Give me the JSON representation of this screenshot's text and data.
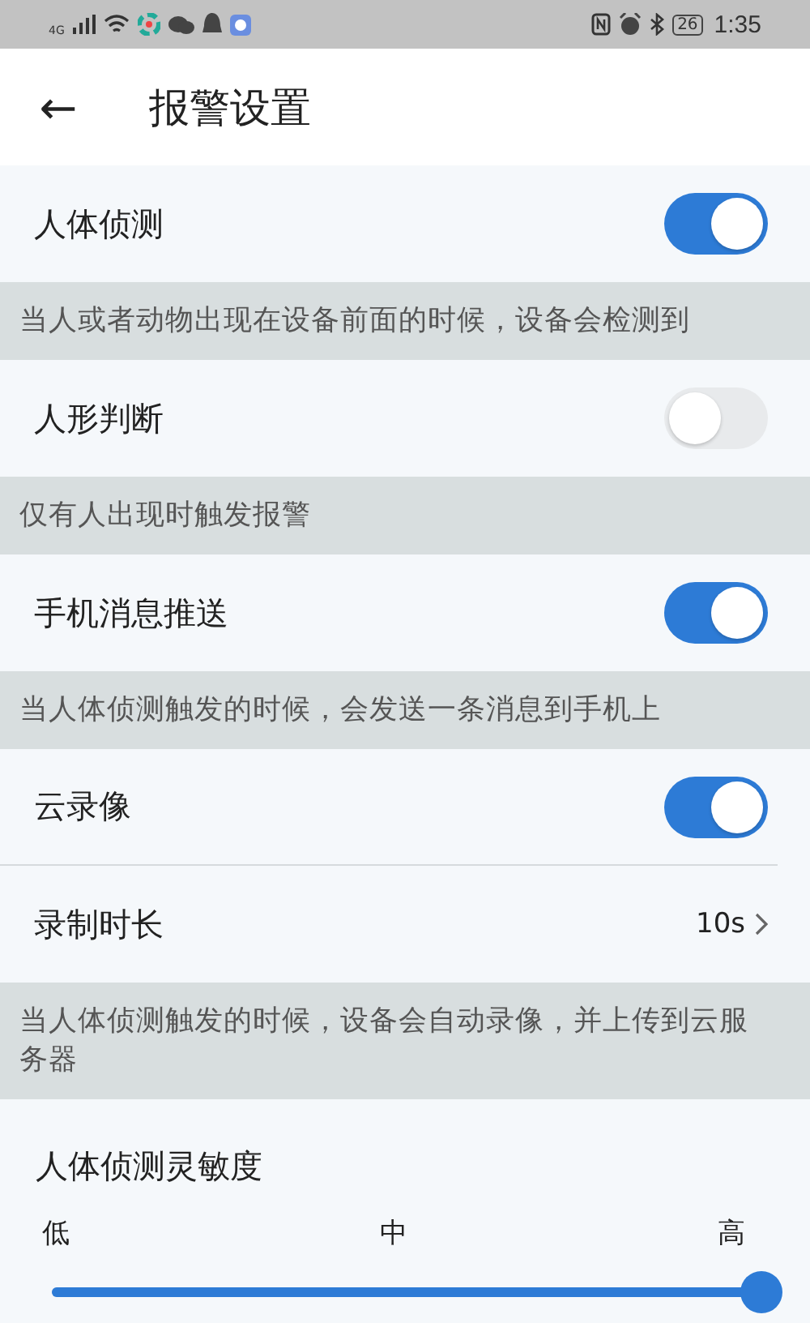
{
  "status_bar": {
    "network": "4G",
    "battery": "26",
    "time": "1:35"
  },
  "header": {
    "back": "←",
    "title": "报警设置"
  },
  "items": [
    {
      "kind": "toggle",
      "label": "人体侦测",
      "on": true
    },
    {
      "kind": "hint",
      "text": "当人或者动物出现在设备前面的时候，设备会检测到"
    },
    {
      "kind": "toggle",
      "label": "人形判断",
      "on": false
    },
    {
      "kind": "hint",
      "text": "仅有人出现时触发报警"
    },
    {
      "kind": "toggle",
      "label": "手机消息推送",
      "on": true
    },
    {
      "kind": "hint",
      "text": "当人体侦测触发的时候，会发送一条消息到手机上"
    },
    {
      "kind": "toggle",
      "label": "云录像",
      "on": true,
      "divider": true
    },
    {
      "kind": "link",
      "label": "录制时长",
      "value": "10s"
    },
    {
      "kind": "hint",
      "text": "当人体侦测触发的时候，设备会自动录像，并上传到云服务器"
    }
  ],
  "sensitivity": {
    "title": "人体侦测灵敏度",
    "labels": [
      "低",
      "中",
      "高"
    ],
    "level": 1.0
  }
}
